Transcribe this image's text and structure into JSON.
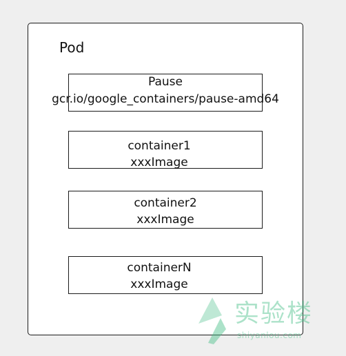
{
  "diagram": {
    "title": "Pod",
    "pause": {
      "name": "Pause",
      "image": "gcr.io/google_containers/pause-amd64"
    },
    "containers": [
      {
        "name": "container1",
        "image": "xxxImage"
      },
      {
        "name": "container2",
        "image": "xxxImage"
      },
      {
        "name": "containerN",
        "image": "xxxImage"
      }
    ]
  },
  "watermark": {
    "name": "实验楼",
    "url": "shiyanlou.com"
  },
  "colors": {
    "background": "#efefef",
    "box_fill": "#ffffff",
    "border": "#1a1a1a",
    "text": "#111111",
    "watermark": "#46be87"
  }
}
